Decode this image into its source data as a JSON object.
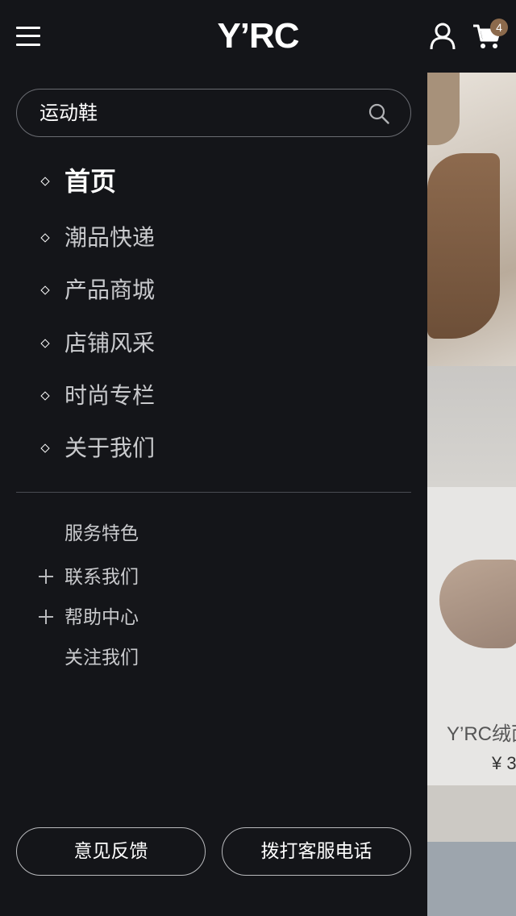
{
  "header": {
    "logo": "Y’RC",
    "cart_count": "4",
    "icons": {
      "menu": "hamburger-icon",
      "user": "user-icon",
      "cart": "cart-icon"
    }
  },
  "drawer": {
    "search": {
      "value": "运动鞋",
      "icon": "search-icon"
    },
    "nav": [
      {
        "label": "首页",
        "active": true
      },
      {
        "label": "潮品快递",
        "active": false
      },
      {
        "label": "产品商城",
        "active": false
      },
      {
        "label": "店铺风采",
        "active": false
      },
      {
        "label": "时尚专栏",
        "active": false
      },
      {
        "label": "关于我们",
        "active": false
      }
    ],
    "sub": [
      {
        "label": "服务特色",
        "expandable": false
      },
      {
        "label": "联系我们",
        "expandable": true
      },
      {
        "label": "帮助中心",
        "expandable": true
      },
      {
        "label": "关注我们",
        "expandable": false
      }
    ],
    "buttons": {
      "feedback": "意见反馈",
      "call": "拨打客服电话"
    }
  },
  "background": {
    "product_name": "Y’RC绒面",
    "price": "¥ 3"
  },
  "colors": {
    "background": "#141519",
    "badge": "#8c6a4c",
    "text": "#ffffff",
    "muted_text": "#c9cacd"
  }
}
